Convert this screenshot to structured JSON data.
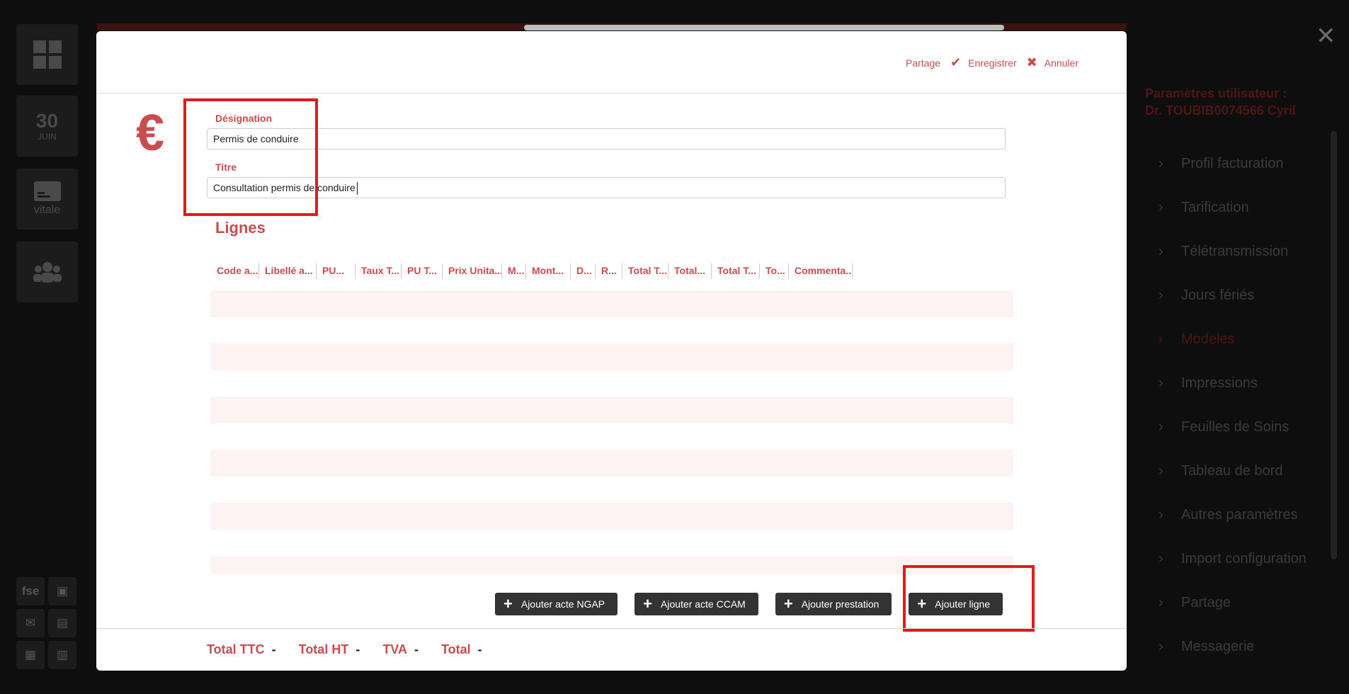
{
  "rail": {
    "date_day": "30",
    "date_month": "JUIN",
    "vitale_label": "vitale",
    "fse_label": "fse"
  },
  "settings_panel": {
    "title_line1": "Paramètres utilisateur :",
    "title_line2": "Dr. TOUBIB0074566 Cyril",
    "items": [
      {
        "label": "Profil facturation",
        "active": false
      },
      {
        "label": "Tarification",
        "active": false
      },
      {
        "label": "Télétransmission",
        "active": false
      },
      {
        "label": "Jours fériés",
        "active": false
      },
      {
        "label": "Modeles",
        "active": true
      },
      {
        "label": "Impressions",
        "active": false
      },
      {
        "label": "Feuilles de Soins",
        "active": false
      },
      {
        "label": "Tableau de bord",
        "active": false
      },
      {
        "label": "Autres paramètres",
        "active": false
      },
      {
        "label": "Import configuration",
        "active": false
      },
      {
        "label": "Partage",
        "active": false
      },
      {
        "label": "Messagerie",
        "active": false
      }
    ]
  },
  "modal": {
    "header": {
      "share_label": "Partage",
      "save_label": "Enregistrer",
      "cancel_label": "Annuler"
    },
    "currency_symbol": "€",
    "designation": {
      "label": "Désignation",
      "value": "Permis de conduire"
    },
    "titre": {
      "label": "Titre",
      "value": "Consultation permis de conduire"
    },
    "lines_title": "Lignes",
    "columns": [
      "Code a...",
      "Libellé a...",
      "PU...",
      "Taux T...",
      "PU T...",
      "Prix Unita...",
      "M...",
      "Mont...",
      "D...",
      "R...",
      "Total T...",
      "Total...",
      "Total T...",
      "To...",
      "Commenta..."
    ],
    "buttons": {
      "add_ngap": "Ajouter acte NGAP",
      "add_ccam": "Ajouter acte CCAM",
      "add_prestation": "Ajouter prestation",
      "add_line": "Ajouter ligne"
    },
    "totals": {
      "ttc_label": "Total TTC",
      "ttc_value": "-",
      "ht_label": "Total HT",
      "ht_value": "-",
      "tva_label": "TVA",
      "tva_value": "-",
      "total_label": "Total",
      "total_value": "-"
    }
  },
  "colors": {
    "accent": "#c94c4f",
    "highlight": "#e01b1b",
    "button_bg": "#333333"
  }
}
